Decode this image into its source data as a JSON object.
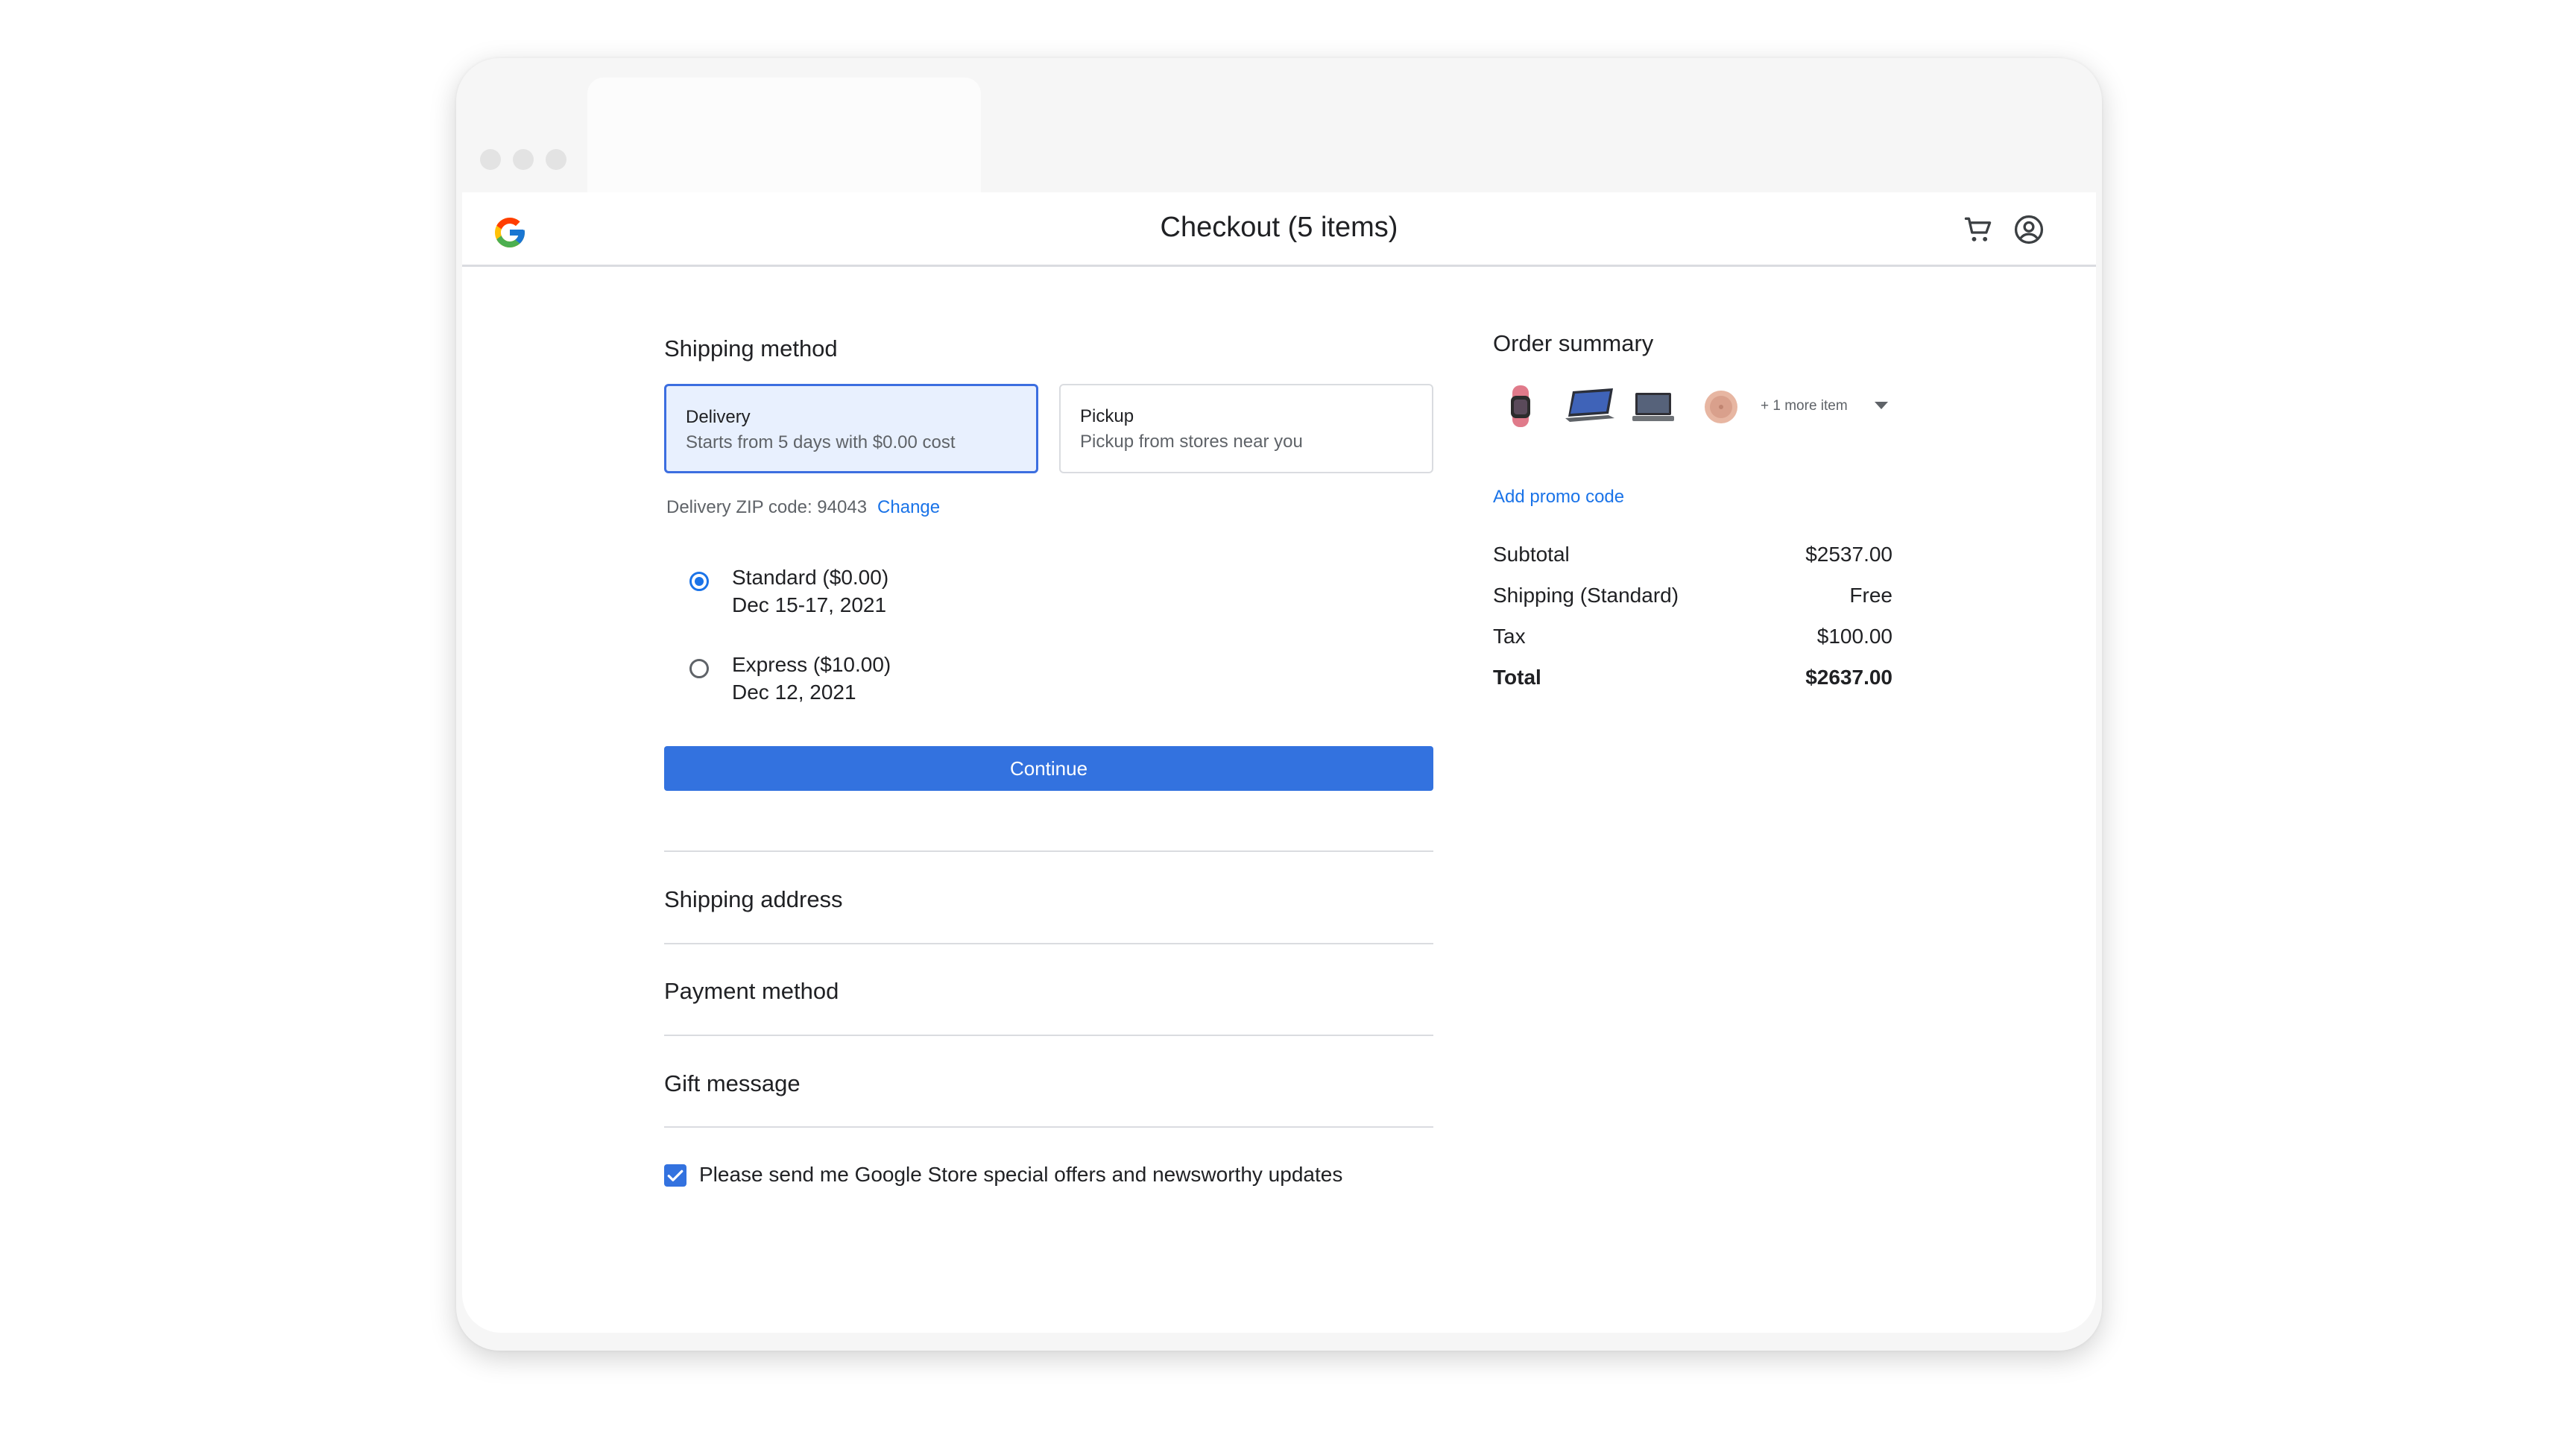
{
  "header": {
    "title": "Checkout (5 items)",
    "cart_icon": "cart-icon",
    "account_icon": "account-circle-icon",
    "logo": "google-g-logo"
  },
  "shipping_method": {
    "title": "Shipping method",
    "options": [
      {
        "label": "Delivery",
        "description": "Starts from 5 days with $0.00 cost",
        "selected": true
      },
      {
        "label": "Pickup",
        "description": "Pickup from stores near you",
        "selected": false
      }
    ],
    "zip_label": "Delivery ZIP code: 94043",
    "change_label": "Change",
    "speeds": [
      {
        "label": "Standard ($0.00)",
        "date": "Dec 15-17, 2021",
        "selected": true
      },
      {
        "label": "Express ($10.00)",
        "date": "Dec 12, 2021",
        "selected": false
      }
    ],
    "continue_label": "Continue"
  },
  "sections": {
    "shipping_address": "Shipping address",
    "payment_method": "Payment method",
    "gift_message": "Gift message"
  },
  "offers": {
    "label": "Please send me Google Store special offers and newsworthy updates",
    "checked": true
  },
  "order_summary": {
    "title": "Order summary",
    "more_items": "+ 1 more item",
    "promo_label": "Add promo code",
    "rows": [
      {
        "label": "Subtotal",
        "value": "$2537.00"
      },
      {
        "label": "Shipping (Standard)",
        "value": "Free"
      },
      {
        "label": "Tax",
        "value": "$100.00"
      },
      {
        "label": "Total",
        "value": "$2637.00"
      }
    ]
  },
  "colors": {
    "accent": "#1a73e8",
    "button": "#3372df",
    "selected_card_bg": "#e8f0fe"
  }
}
